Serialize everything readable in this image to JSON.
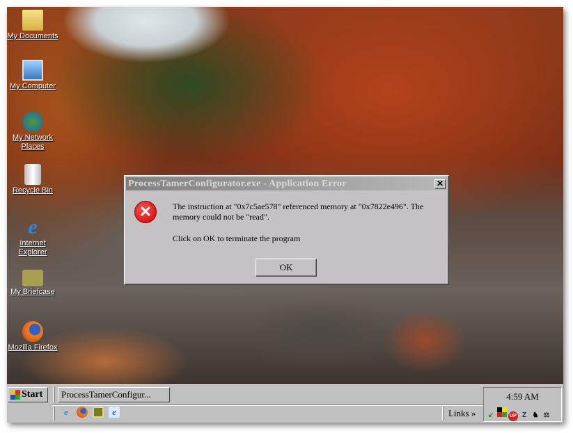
{
  "desktop": {
    "icons": [
      {
        "label": "My Documents",
        "icon": "folder-documents-icon"
      },
      {
        "label": "My Computer",
        "icon": "computer-icon"
      },
      {
        "label": "My Network Places",
        "icon": "network-icon"
      },
      {
        "label": "Recycle Bin",
        "icon": "recycle-bin-icon"
      },
      {
        "label": "Internet Explorer",
        "icon": "internet-explorer-icon"
      },
      {
        "label": "My Briefcase",
        "icon": "briefcase-icon"
      },
      {
        "label": "Mozilla Firefox",
        "icon": "firefox-icon"
      }
    ]
  },
  "dialog": {
    "title": "ProcessTamerConfigurator.exe - Application Error",
    "message1": "The instruction at \"0x7c5ae578\" referenced memory at \"0x7822e496\". The memory could not be \"read\".",
    "message2": "Click on OK to terminate the program",
    "ok": "OK",
    "close": "✕",
    "icon": "error-icon",
    "error_color": "#e00000"
  },
  "taskbar": {
    "start": "Start",
    "task": "ProcessTamerConfigur...",
    "links": "Links",
    "chevron": "»",
    "clock": "4:59 AM",
    "quicklaunch": [
      "internet-explorer-icon",
      "firefox-icon",
      "clock-icon",
      "outlook-express-icon"
    ],
    "tray": [
      "network-icon",
      "color-icon",
      "popup-blocker-icon",
      "z-icon",
      "dog-icon",
      "scales-icon"
    ]
  }
}
